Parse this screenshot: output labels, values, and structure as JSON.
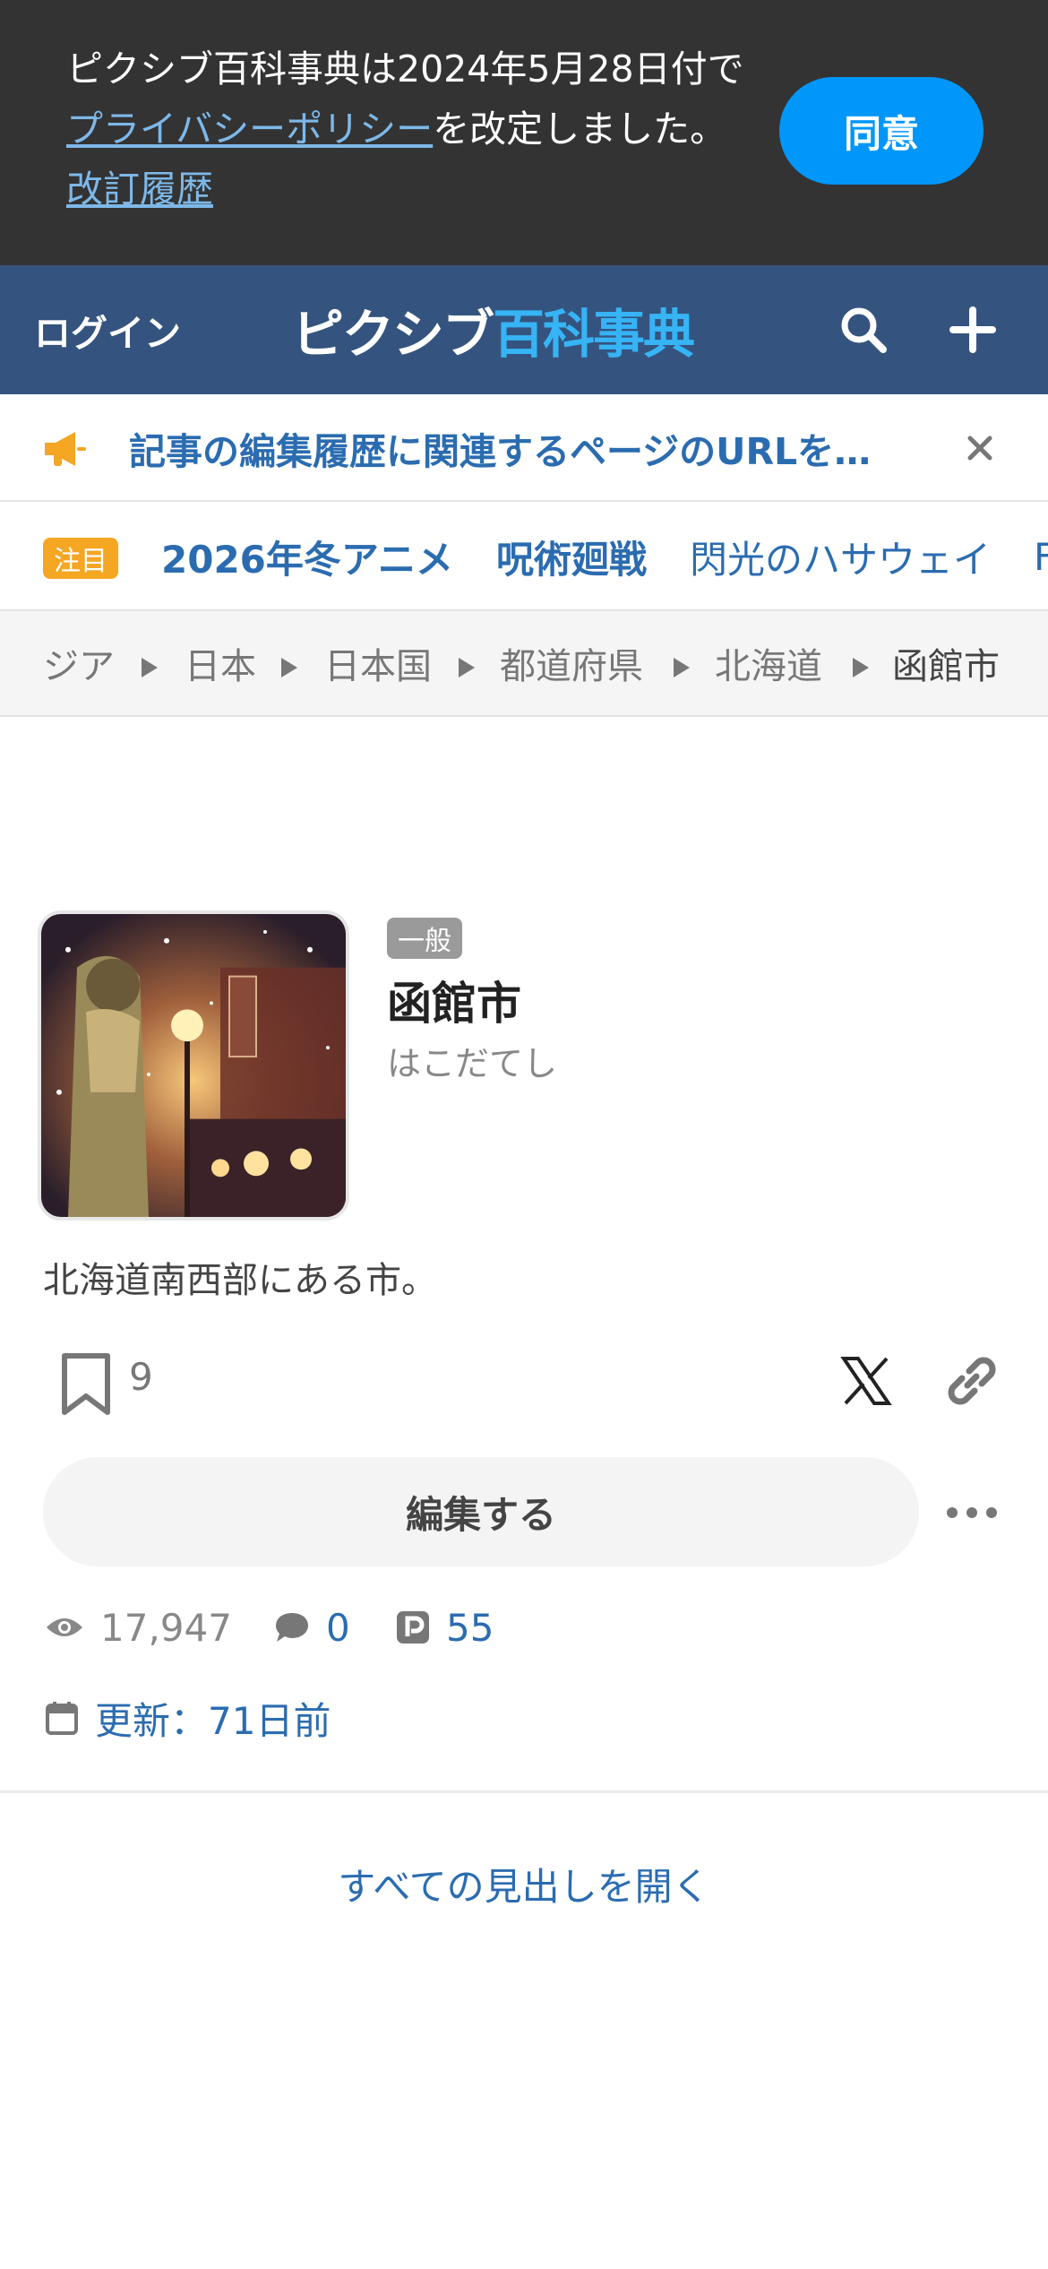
{
  "privacy_banner": {
    "text_before": "ピクシブ百科事典は2024年5月28日付で",
    "policy_link": "プライバシーポリシー",
    "text_middle": "を改定しました。",
    "history_link": "改訂履歴",
    "agree_label": "同意"
  },
  "header": {
    "login_label": "ログイン",
    "logo_part1": "ピクシブ",
    "logo_part2": "百科事典",
    "icons": [
      "search-icon",
      "plus-icon"
    ]
  },
  "notice": {
    "text": "記事の編集履歴に関連するページのURLを…",
    "icon": "megaphone-icon",
    "accent_color": "#f5a623"
  },
  "trending": {
    "badge": "注目",
    "tags": [
      "2026年冬アニメ",
      "呪術廻戦",
      "閃光のハサウェイ",
      "F"
    ]
  },
  "breadcrumb": {
    "items": [
      "ジア",
      "日本",
      "日本国",
      "都道府県",
      "北海道",
      "函館市"
    ]
  },
  "article": {
    "category": "一般",
    "title": "函館市",
    "reading": "はこだてし",
    "summary": "北海道南西部にある市。",
    "bookmark_count": "9",
    "edit_label": "編集する",
    "views": "17,947",
    "comments": "0",
    "pixiv_works": "55",
    "updated": "更新：71日前",
    "open_headings": "すべての見出しを開く"
  },
  "colors": {
    "header_bg": "#34547f",
    "banner_bg": "#333333",
    "agree_button": "#0096fa",
    "link_blue": "#2b6cb0",
    "logo_accent": "#36b4f5"
  }
}
